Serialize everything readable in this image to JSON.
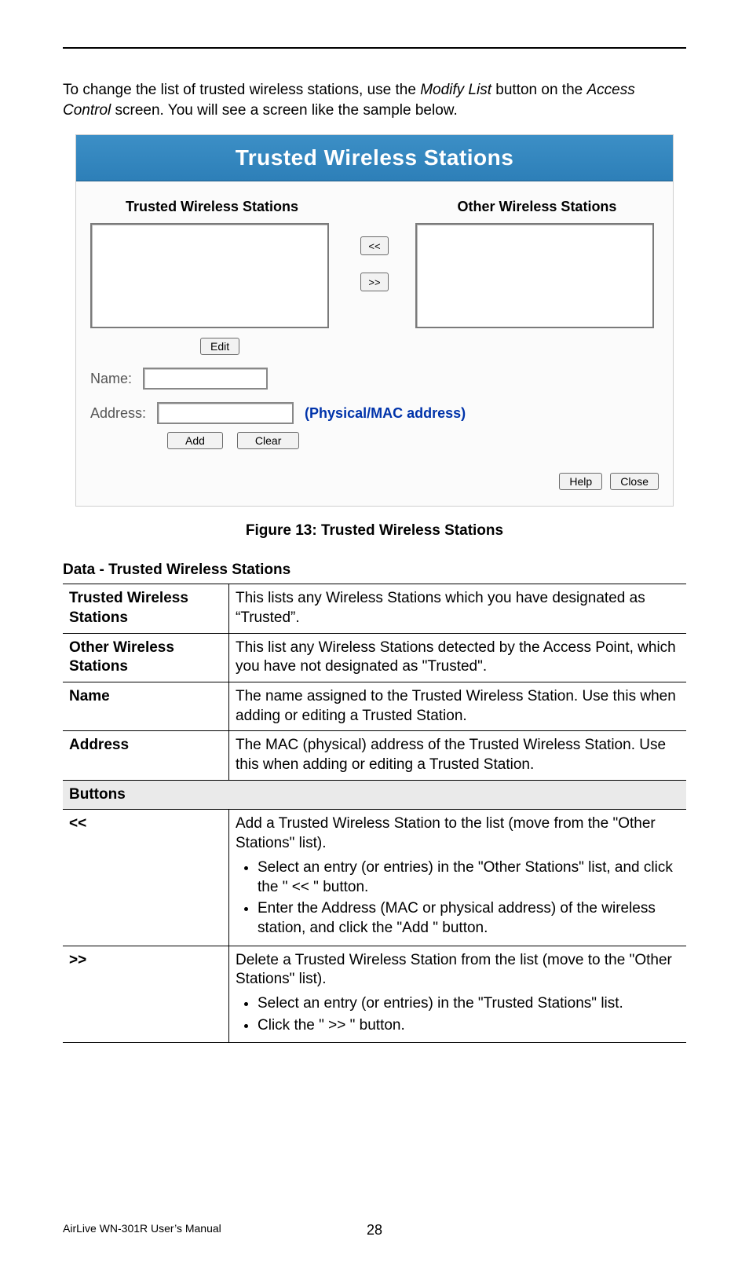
{
  "intro": {
    "before_italic1": "To change the list of trusted wireless stations, use the ",
    "italic1": "Modify List",
    "between": " button on the ",
    "italic2": "Access Control",
    "after": " screen. You will see a screen like the sample below."
  },
  "shot": {
    "title": "Trusted Wireless Stations",
    "col_trusted": "Trusted Wireless Stations",
    "col_other": "Other Wireless Stations",
    "btn_move_left": "<<",
    "btn_move_right": ">>",
    "btn_edit": "Edit",
    "label_name": "Name:",
    "label_address": "Address:",
    "mac_note": "(Physical/MAC address)",
    "btn_add": "Add",
    "btn_clear": "Clear",
    "btn_help": "Help",
    "btn_close": "Close"
  },
  "figure_caption": "Figure 13: Trusted Wireless Stations",
  "data_heading": "Data - Trusted Wireless Stations",
  "rows": {
    "r0_l": "Trusted Wireless Stations",
    "r0_r": "This lists any Wireless Stations which you have designated as “Trusted”.",
    "r1_l": "Other Wireless Stations",
    "r1_r": "This list any Wireless Stations detected by the Access Point, which you have not designated as \"Trusted\".",
    "r2_l": "Name",
    "r2_r": "The name assigned to the Trusted Wireless Station. Use this when adding or editing a Trusted Station.",
    "r3_l": "Address",
    "r3_r": "The MAC (physical) address of the Trusted Wireless Station. Use this when adding or editing a Trusted Station.",
    "buttons_hdr": "Buttons",
    "r4_l": "<<",
    "r4_main": "Add a Trusted Wireless Station to the list (move from the \"Other Stations\" list).",
    "r4_b1": "Select an entry (or entries) in the \"Other Stations\" list, and click the \" << \" button.",
    "r4_b2": "Enter the Address (MAC or physical address) of the wireless station, and click the \"Add \" button.",
    "r5_l": ">>",
    "r5_main": "Delete a Trusted Wireless Station from the list (move to the \"Other Stations\" list).",
    "r5_b1": "Select an entry (or entries) in the \"Trusted Stations\" list.",
    "r5_b2": "Click the \" >> \" button."
  },
  "footer": {
    "manual": "AirLive WN-301R User’s Manual",
    "page": "28"
  }
}
